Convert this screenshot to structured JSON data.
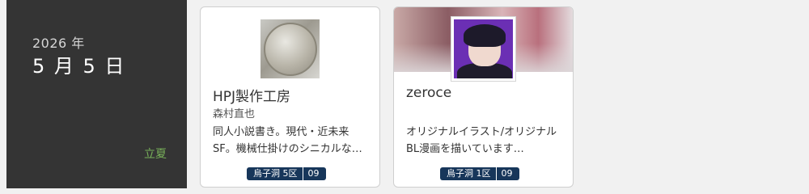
{
  "date": {
    "year": "2026 年",
    "month_day": "5 月 5 日",
    "season": "立夏"
  },
  "circles": [
    {
      "name": "HPJ製作工房",
      "author": "森村直也",
      "description": "同人小説書き。現代・近未来SF。機械仕掛けのシニカルな物語を書いています。",
      "hall": "烏子洞 5区",
      "number": "09"
    },
    {
      "name": "zeroce",
      "author": "",
      "description": "オリジナルイラスト/オリジナルBL漫画を描いています…",
      "hall": "烏子洞 1区",
      "number": "09"
    }
  ],
  "colors": {
    "date_panel_bg": "#343434",
    "season_text": "#79b25a",
    "tag_bg": "#17365a",
    "avatar_bg": "#6b2fb4"
  }
}
